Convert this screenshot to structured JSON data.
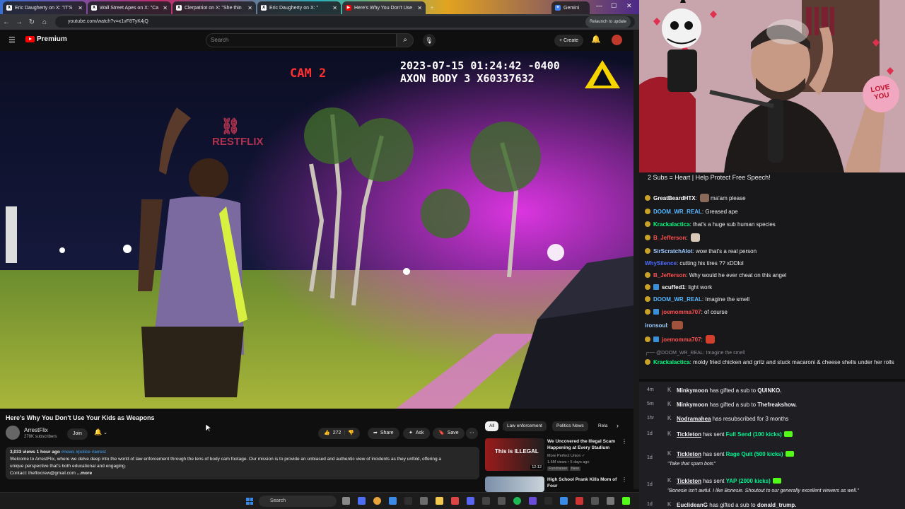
{
  "browser": {
    "tabs": [
      {
        "title": "Eric Daugherty on X: \"IT'S"
      },
      {
        "title": "Wall Street Apes on X: \"Ca"
      },
      {
        "title": "Clerpatriot on X: \"She thin"
      },
      {
        "title": "Eric Daugherty on X: \""
      },
      {
        "title": "Here's Why You Don't Use"
      },
      {
        "title": "Gemini"
      }
    ],
    "url": "youtube.com/watch?v=x1vF8TyK4jQ",
    "relaunch_label": "Relaunch to update"
  },
  "youtube": {
    "brand": "Premium",
    "search_placeholder": "Search",
    "create_label": "Create",
    "video": {
      "cam_label": "CAM 2",
      "timestamp_line1": "2023-07-15 01:24:42 -0400",
      "timestamp_line2": "AXON BODY 3 X60337632",
      "watermark": "RESTFLIX"
    },
    "title": "Here's Why You Don't Use Your Kids as Weapons",
    "channel": "ArrestFlix",
    "subscribers": "278K subscribers",
    "join_label": "Join",
    "likes": "272",
    "share_label": "Share",
    "ask_label": "Ask",
    "save_label": "Save",
    "description": {
      "meta": "3,033 views  1 hour ago",
      "tags": "#news #police #arrest",
      "line1": "Welcome to ArrestFlix, where we delve deep into the world of law enforcement through the lens of body cam footage. Our mission is to provide an unbiased and authentic view of incidents as they unfold, offering a",
      "line2": "unique perspective that's both educational and engaging.",
      "line3": "Contact: theflixcrew@gmail.com",
      "more": "...more"
    },
    "chips": [
      "All",
      "Law enforcement",
      "Politics News",
      "Rela"
    ],
    "recommendations": [
      {
        "title": "We Uncovered the Illegal Scam Happening at Every Stadium",
        "channel": "More Perfect Union",
        "stats": "1.6M views • 5 days ago",
        "badge1": "Fundraiser",
        "badge2": "New",
        "duration": "12:12",
        "thumb_text": "This is ILLEGAL"
      },
      {
        "title": "High School Prank Kills Mom of Four",
        "channel": "",
        "stats": "",
        "badge1": "",
        "badge2": "",
        "duration": "",
        "thumb_text": ""
      }
    ]
  },
  "taskbar": {
    "search_placeholder": "Search"
  },
  "stream": {
    "banner": "2 Subs = Heart | Help Protect Free Speech!",
    "chat": [
      {
        "user": "GreatBeardHTX",
        "color": "#ffffff",
        "text": "ma'am please",
        "emote": true,
        "badge": "y"
      },
      {
        "user": "DOOM_WR_REAL",
        "color": "#a970ff",
        "text": "Greased ape",
        "emote": false,
        "badge": "y"
      },
      {
        "user": "Krackalactica",
        "color": "#00ff7f",
        "text": "that's a huge sub human species",
        "emote": false,
        "badge": "y"
      },
      {
        "user": "B_Jefferson",
        "color": "#ff4f4f",
        "text": "",
        "emote": true,
        "badge": "y"
      },
      {
        "user": "SirScratchAlot",
        "color": "#9ecbff",
        "text": "wow that's a real person",
        "emote": false,
        "badge": "y"
      },
      {
        "user": "WhySilence",
        "color": "#4f6bff",
        "text": "cutting his tires ?? xDDlol",
        "emote": false,
        "badge": ""
      },
      {
        "user": "B_Jefferson",
        "color": "#ff4f4f",
        "text": "Why would he ever cheat on this angel",
        "emote": false,
        "badge": "y"
      },
      {
        "user": "scuffed1",
        "color": "#ffffff",
        "text": "light work",
        "emote": false,
        "badge": "yb"
      },
      {
        "user": "DOOM_WR_REAL",
        "color": "#a970ff",
        "text": "Imagine the smell",
        "emote": false,
        "badge": "y"
      },
      {
        "user": "joemomma707",
        "color": "#ff4f4f",
        "text": "of course",
        "emote": false,
        "badge": "yb"
      },
      {
        "user": "ironsoul",
        "color": "#9ecbff",
        "text": "",
        "emote": true,
        "badge": ""
      },
      {
        "user": "joemomma707",
        "color": "#ff4f4f",
        "text": "",
        "emote": true,
        "badge": "yb"
      }
    ],
    "reply_ref": "@DOOM_WR_REAL: Imagine the smell",
    "reply": {
      "user": "Krackalactica",
      "text": "moldy fried chicken and gritz and stuck macaroni & cheese shells under her rolls"
    },
    "events": [
      {
        "time": "4m",
        "name": "Minkymoon",
        "text": " has gifted a sub to ",
        "target": "QUINKO."
      },
      {
        "time": "5m",
        "name": "Minkymoon",
        "text": " has gifted a sub to ",
        "target": "Thefreakshow."
      },
      {
        "time": "1hr",
        "name": "Nodramahea",
        "text": " has resubscribed for 3 months",
        "target": ""
      },
      {
        "time": "1d",
        "name": "Tickleton",
        "text": " has sent ",
        "target": "Full Send (100 kicks)"
      },
      {
        "time": "1d",
        "name": "Tickleton",
        "text": " has sent ",
        "target": "Rage Quit (500 kicks)",
        "quote": "\"Take that spam bots\""
      },
      {
        "time": "1d",
        "name": "Tickleton",
        "text": " has sent ",
        "target": "YAP (2000 kicks)",
        "quote": "\"Bonesie isn't awful. I like Bonesie. Shoutout to our generally excellent viewers as well.\""
      },
      {
        "time": "1d",
        "name": "EuclideanG",
        "text": " has gifted a sub to ",
        "target": "donald_trump."
      }
    ],
    "sign_text": "LOVE YOU"
  }
}
